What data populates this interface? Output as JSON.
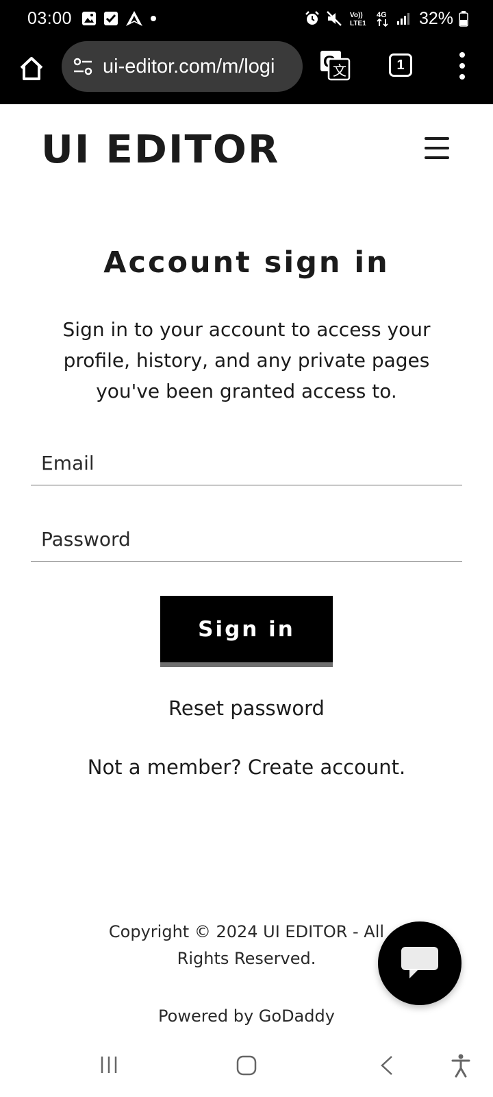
{
  "status_bar": {
    "time": "03:00",
    "battery": "32%",
    "network_label_top": "Vo)) 4G",
    "network_label_bottom": "LTE1"
  },
  "browser": {
    "url": "ui-editor.com/m/logi",
    "tab_count": "1"
  },
  "site": {
    "logo": "UI EDITOR"
  },
  "signin": {
    "title": "Account sign in",
    "intro": "Sign in to your account to access your profile, history, and any private pages you've been granted access to.",
    "email_placeholder": "Email",
    "password_placeholder": "Password",
    "submit_label": "Sign in",
    "reset_label": "Reset password",
    "member_prefix": "Not a member?",
    "create_label": "Create account."
  },
  "footer": {
    "copyright": "Copyright © 2024 UI EDITOR - All Rights Reserved.",
    "powered_prefix": "Powered by",
    "powered_brand": "GoDaddy"
  },
  "icons": {
    "home": "home-icon",
    "site_settings": "tune-icon",
    "translate": "translate-icon",
    "more": "more-vert-icon",
    "menu": "hamburger-menu-icon",
    "chat": "chat-bubble-icon"
  },
  "colors": {
    "browser_chrome": "#000000",
    "url_pill": "#3a3a3a",
    "primary_button": "#000000",
    "button_underline": "#6f6f6f",
    "text": "#1b1b1b"
  }
}
